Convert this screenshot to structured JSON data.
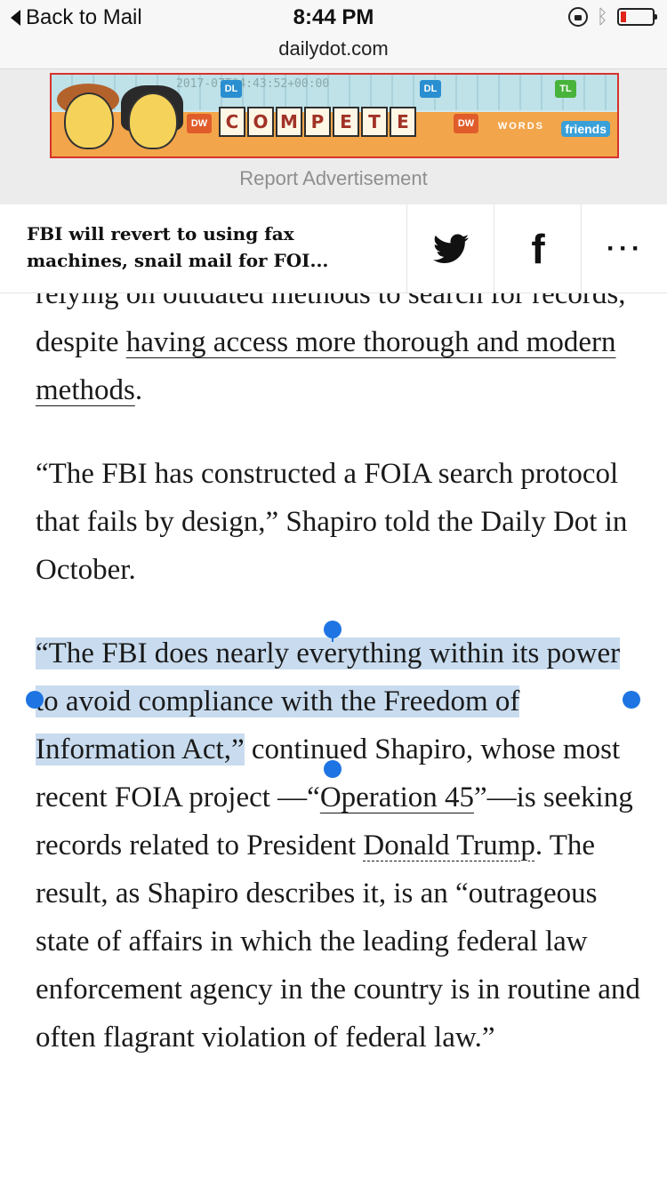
{
  "status_bar": {
    "back_label": "Back to Mail",
    "time": "8:44 PM",
    "battery_color": "#e2231a"
  },
  "browser": {
    "domain": "dailydot.com"
  },
  "ad": {
    "stamp": "2017-07T04:43:52+00:00",
    "tile_dl": "DL",
    "tile_tl": "TL",
    "tile_dw": "DW",
    "word_letters": [
      "C",
      "O",
      "M",
      "P",
      "E",
      "T",
      "E"
    ],
    "brand_words": "WORDS",
    "brand_friends": "friends",
    "report_label": "Report Advertisement"
  },
  "share": {
    "headline": "FBI will revert to using fax machines, snail mail for FOI...",
    "twitter_icon": "twitter-icon",
    "facebook_glyph": "f",
    "more_glyph": "···"
  },
  "article": {
    "p1_a": "relying on outdated methods to search for records, despite ",
    "p1_link": "having access more thorough and modern methods",
    "p1_b": ".",
    "p2": "“The FBI has constructed a FOIA search protocol that fails by design,” Shapiro told the Daily Dot in October.",
    "p3_selected": "“The FBI does nearly everything within its power to avoid compliance with the Freedom of Information Act,”",
    "p3_a": " continued Shapiro, whose most recent FOIA project —“",
    "p3_link1": "Operation 45",
    "p3_b": "”—is seeking records related to President ",
    "p3_link2": "Donald Trump",
    "p3_c": ". The result, as Shapiro describes it, is an “outrageous state of affairs in which the leading federal law enforcement agency in the country is in routine and often flagrant violation of federal law.”"
  },
  "colors": {
    "selection": "#c9dcef",
    "handle": "#1e74e2",
    "ad_border": "#d6322b"
  }
}
